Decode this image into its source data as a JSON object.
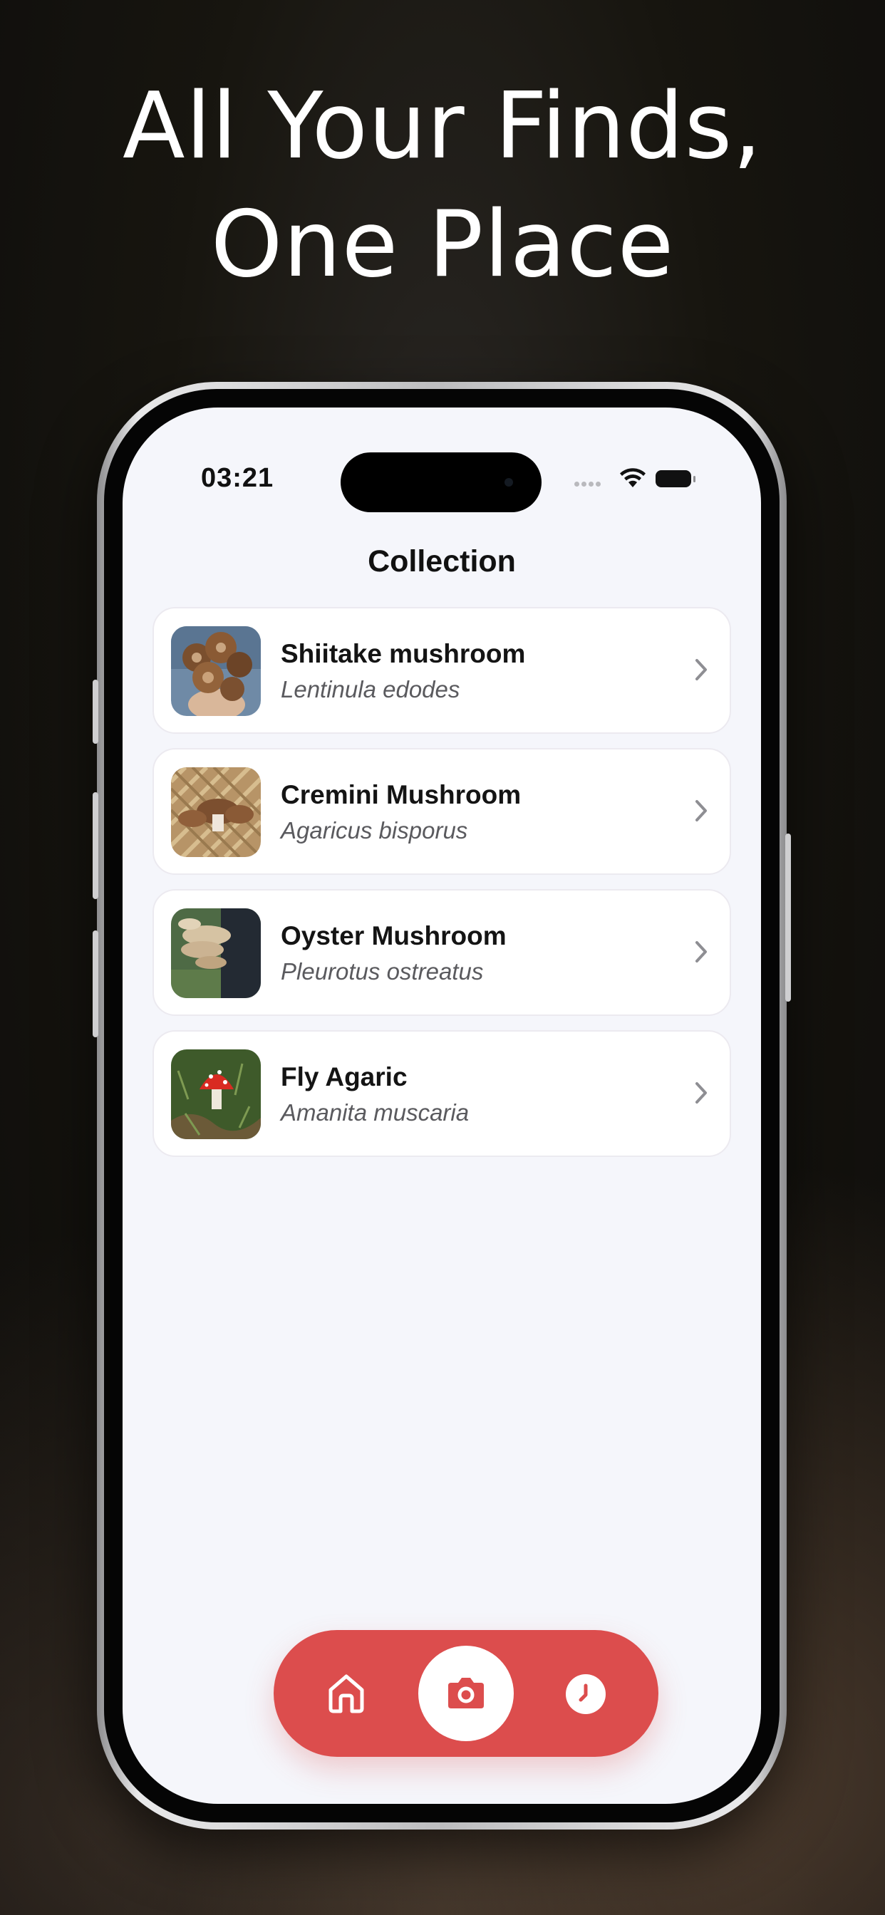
{
  "headline": {
    "line1": "All Your Finds,",
    "line2": "One Place"
  },
  "status_bar": {
    "time": "03:21"
  },
  "screen": {
    "title": "Collection"
  },
  "collection": [
    {
      "name": "Shiitake mushroom",
      "scientific_name": "Lentinula edodes"
    },
    {
      "name": "Cremini Mushroom",
      "scientific_name": "Agaricus bisporus"
    },
    {
      "name": "Oyster Mushroom",
      "scientific_name": "Pleurotus ostreatus"
    },
    {
      "name": "Fly Agaric",
      "scientific_name": "Amanita muscaria"
    }
  ],
  "tab_bar": {
    "items": [
      "home-icon",
      "camera-icon",
      "history-icon"
    ],
    "color": "#dc4d4d"
  },
  "colors": {
    "screen_background": "#f5f6fb",
    "accent": "#dc4d4d"
  }
}
